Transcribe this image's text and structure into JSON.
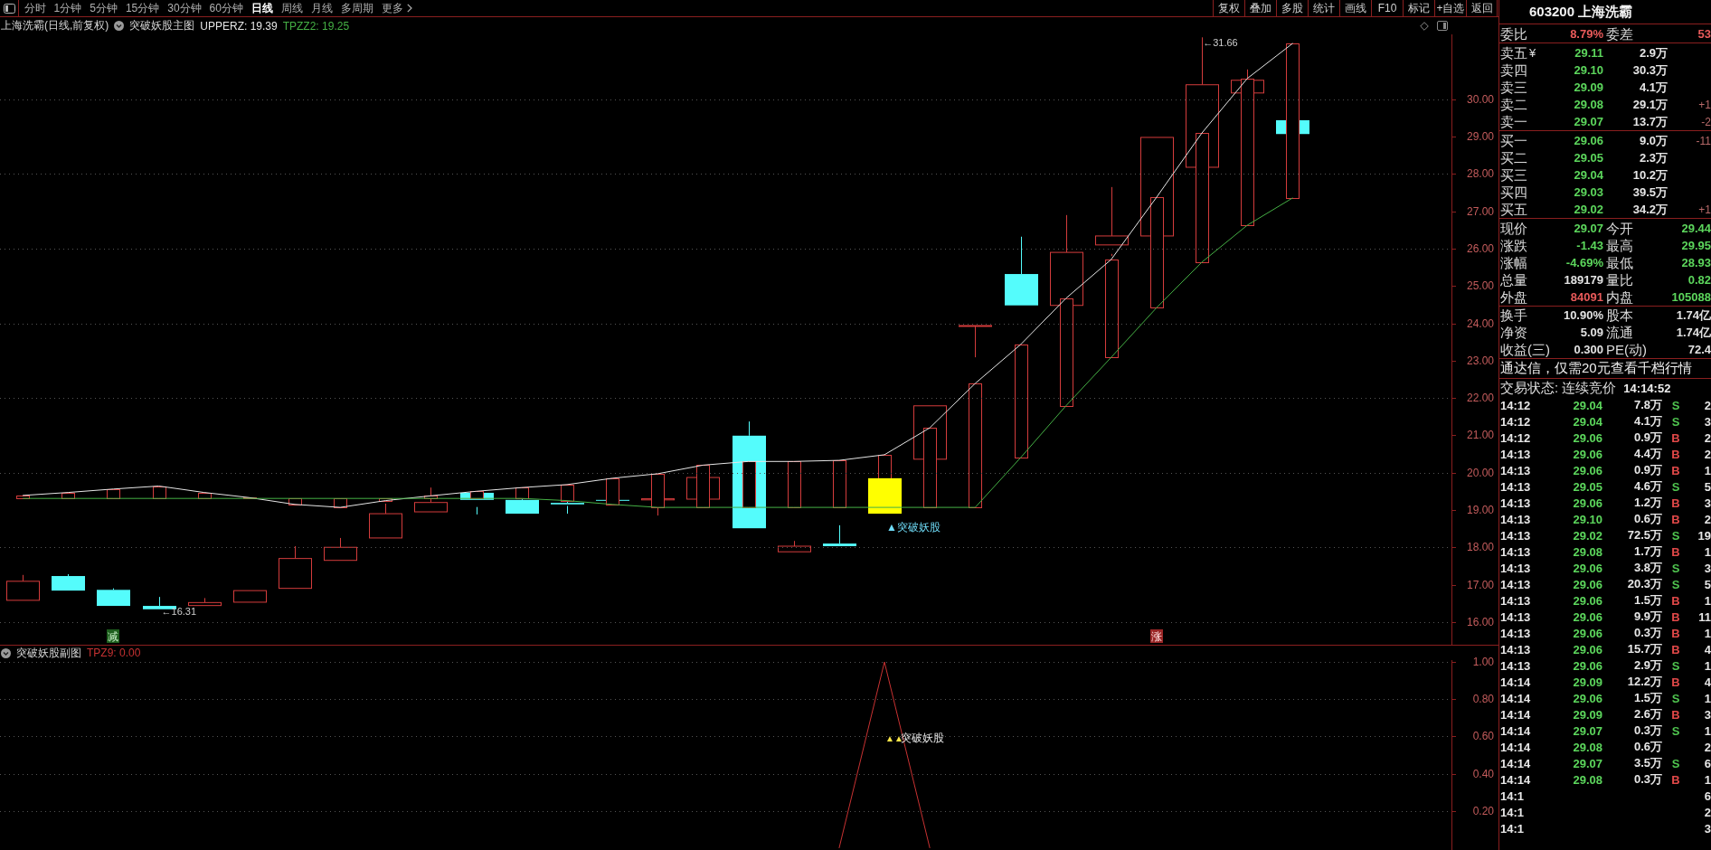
{
  "toolbar": {
    "periods": [
      {
        "label": "分时",
        "selected": false,
        "kind": "period"
      },
      {
        "label": "1分钟",
        "selected": false,
        "kind": "period"
      },
      {
        "label": "5分钟",
        "selected": false,
        "kind": "period"
      },
      {
        "label": "15分钟",
        "selected": false,
        "kind": "period"
      },
      {
        "label": "30分钟",
        "selected": false,
        "kind": "period"
      },
      {
        "label": "60分钟",
        "selected": false,
        "kind": "period"
      },
      {
        "label": "日线",
        "selected": true,
        "kind": "period"
      },
      {
        "label": "周线",
        "selected": false,
        "kind": "period"
      },
      {
        "label": "月线",
        "selected": false,
        "kind": "period"
      },
      {
        "label": "多周期",
        "selected": false,
        "kind": "period"
      },
      {
        "label": "更多",
        "selected": false,
        "kind": "menu"
      }
    ],
    "tools": [
      "复权",
      "叠加",
      "多股",
      "统计",
      "画线",
      "F10",
      "标记",
      "+自选",
      "返回"
    ]
  },
  "main_chart": {
    "title": "上海洗霸(日线,前复权)",
    "indicator": "突破妖股主图",
    "readouts": [
      "UPPERZ: 19.39",
      "TPZZ2: 19.25"
    ],
    "low_label": "←16.31",
    "high_label": "←31.66",
    "signal_label": "▲突破妖股",
    "tags": [
      {
        "label": "减",
        "kind": "sell"
      },
      {
        "label": "涨",
        "kind": "buy"
      }
    ],
    "chart_data": {
      "type": "line",
      "grid": true,
      "categories": [
        null,
        null,
        null,
        null,
        null,
        null,
        null,
        null,
        null,
        null,
        null,
        null,
        null,
        null,
        null,
        null,
        null,
        null,
        null,
        null,
        null,
        null,
        null,
        null,
        null,
        null,
        null,
        null,
        null,
        null,
        null,
        null
      ],
      "ylim": [
        15.39,
        31.74
      ],
      "yticks": [
        {
          "value": 30,
          "label": "30.00"
        },
        {
          "value": 29,
          "label": "29.00"
        },
        {
          "value": 28,
          "label": "28.00"
        },
        {
          "value": 27,
          "label": "27.00"
        },
        {
          "value": 26,
          "label": "26.00"
        },
        {
          "value": 25,
          "label": "25.00"
        },
        {
          "value": 24,
          "label": "24.00"
        },
        {
          "value": 23,
          "label": "23.00"
        },
        {
          "value": 22,
          "label": "22.00"
        },
        {
          "value": 21,
          "label": "21.00"
        },
        {
          "value": 20,
          "label": "20.00"
        },
        {
          "value": 19,
          "label": "19.00"
        },
        {
          "value": 18,
          "label": "18.00"
        },
        {
          "value": 17,
          "label": "17.00"
        },
        {
          "value": 16,
          "label": "16.00"
        }
      ],
      "series": [
        {
          "color": "#e6e6e6",
          "values": [
            19.39,
            19.47,
            19.56,
            19.64,
            19.47,
            19.33,
            19.15,
            19.07,
            19.25,
            19.38,
            19.5,
            19.6,
            19.68,
            19.85,
            19.97,
            20.2,
            20.3,
            20.3,
            20.33,
            20.48,
            21.2,
            22.39,
            23.43,
            24.67,
            25.71,
            27.38,
            29.1,
            30.56,
            31.5,
            null,
            null,
            null
          ]
        },
        {
          "color": "#45b045",
          "values": [
            19.31,
            19.31,
            19.31,
            19.31,
            19.31,
            19.31,
            19.31,
            19.31,
            19.31,
            19.31,
            19.31,
            19.31,
            19.25,
            19.15,
            19.07,
            19.07,
            19.07,
            19.07,
            19.07,
            19.07,
            19.07,
            19.07,
            20.4,
            21.79,
            23.09,
            24.42,
            25.64,
            26.63,
            27.36,
            null,
            null,
            null
          ]
        }
      ]
    }
  },
  "sub_chart": {
    "indicator": "突破妖股副图",
    "readout": "TPZ9: 0.00",
    "signal_marker": "▲▲",
    "signal_label": "突破妖股",
    "chart_data": {
      "type": "line",
      "grid": true,
      "categories": [
        null,
        null,
        null,
        null,
        null,
        null,
        null,
        null,
        null,
        null,
        null,
        null,
        null,
        null,
        null,
        null,
        null,
        null,
        null,
        null,
        null,
        null,
        null,
        null,
        null,
        null,
        null,
        null,
        null,
        null,
        null,
        null
      ],
      "ylim": [
        -0.01,
        1.01
      ],
      "yticks": [
        {
          "value": 1,
          "label": "1.00"
        },
        {
          "value": 0.8,
          "label": "0.80"
        },
        {
          "value": 0.6,
          "label": "0.60"
        },
        {
          "value": 0.4,
          "label": "0.40"
        },
        {
          "value": 0.2,
          "label": "0.20"
        }
      ],
      "series": [
        {
          "color": "#c83232",
          "values": [
            null,
            null,
            null,
            null,
            null,
            null,
            null,
            null,
            null,
            null,
            null,
            null,
            null,
            null,
            null,
            null,
            null,
            null,
            0,
            1,
            0,
            null,
            null,
            null,
            null,
            null,
            null,
            null,
            null,
            null,
            null,
            null
          ]
        }
      ]
    }
  },
  "quote": {
    "title": "603200 上海洗霸",
    "ratio": [
      {
        "label": "委比",
        "value": "8.79%",
        "color": "#e85a5a"
      },
      {
        "label": "委差",
        "value": "53",
        "color": "#e85a5a"
      }
    ],
    "asks": [
      {
        "label": "卖五",
        "marker": "¥",
        "price": "29.11",
        "color": "#5cd65c",
        "volume": "2.9万"
      },
      {
        "label": "卖四",
        "price": "29.10",
        "color": "#5cd65c",
        "volume": "30.3万"
      },
      {
        "label": "卖三",
        "price": "29.09",
        "color": "#5cd65c",
        "volume": "4.1万"
      },
      {
        "label": "卖二",
        "price": "29.08",
        "color": "#5cd65c",
        "volume": "29.1万",
        "change": "+1"
      },
      {
        "label": "卖一",
        "price": "29.07",
        "color": "#5cd65c",
        "volume": "13.7万",
        "change": "-2"
      }
    ],
    "bids": [
      {
        "label": "买一",
        "price": "29.06",
        "color": "#5cd65c",
        "volume": "9.0万",
        "change": "-11"
      },
      {
        "label": "买二",
        "price": "29.05",
        "color": "#5cd65c",
        "volume": "2.3万"
      },
      {
        "label": "买三",
        "price": "29.04",
        "color": "#5cd65c",
        "volume": "10.2万"
      },
      {
        "label": "买四",
        "price": "29.03",
        "color": "#5cd65c",
        "volume": "39.5万"
      },
      {
        "label": "买五",
        "price": "29.02",
        "color": "#5cd65c",
        "volume": "34.2万",
        "change": "+1"
      }
    ],
    "stats": [
      {
        "label": "现价",
        "value": "29.07",
        "color": "#5cd65c"
      },
      {
        "label": "今开",
        "value": "29.44",
        "color": "#5cd65c"
      },
      {
        "label": "涨跌",
        "value": "-1.43",
        "color": "#5cd65c"
      },
      {
        "label": "最高",
        "value": "29.95",
        "color": "#5cd65c"
      },
      {
        "label": "涨幅",
        "value": "-4.69%",
        "color": "#5cd65c"
      },
      {
        "label": "最低",
        "value": "28.93",
        "color": "#5cd65c"
      },
      {
        "label": "总量",
        "value": "189179",
        "color": "#e2e2e2"
      },
      {
        "label": "量比",
        "value": "0.82",
        "color": "#5cd65c"
      },
      {
        "label": "外盘",
        "value": "84091",
        "color": "#e85a5a"
      },
      {
        "label": "内盘",
        "value": "105088",
        "color": "#5cd65c"
      }
    ],
    "fundamentals": [
      {
        "label": "换手",
        "value": "10.90%"
      },
      {
        "label": "股本",
        "value": "1.74亿"
      },
      {
        "label": "净资",
        "value": "5.09"
      },
      {
        "label": "流通",
        "value": "1.74亿"
      },
      {
        "label": "收益(三)",
        "value": "0.300"
      },
      {
        "label": "PE(动)",
        "value": "72.4"
      }
    ],
    "notice": "通达信，仅需20元查看千档行情",
    "status": {
      "label": "交易状态: 连续竞价",
      "time": "14:14:52"
    },
    "trades": [
      {
        "time": "14:12",
        "price": "29.04",
        "color": "#5cd65c",
        "volume": "7.8万",
        "side": "S",
        "kind": "sell",
        "count": "2"
      },
      {
        "time": "14:12",
        "price": "29.04",
        "color": "#5cd65c",
        "volume": "4.1万",
        "side": "S",
        "kind": "sell",
        "count": "3"
      },
      {
        "time": "14:12",
        "price": "29.06",
        "color": "#5cd65c",
        "volume": "0.9万",
        "side": "B",
        "kind": "buy",
        "count": "2"
      },
      {
        "time": "14:13",
        "price": "29.06",
        "color": "#5cd65c",
        "volume": "4.4万",
        "side": "B",
        "kind": "buy",
        "count": "2"
      },
      {
        "time": "14:13",
        "price": "29.06",
        "color": "#5cd65c",
        "volume": "0.9万",
        "side": "B",
        "kind": "buy",
        "count": "1"
      },
      {
        "time": "14:13",
        "price": "29.05",
        "color": "#5cd65c",
        "volume": "4.6万",
        "side": "S",
        "kind": "sell",
        "count": "5"
      },
      {
        "time": "14:13",
        "price": "29.06",
        "color": "#5cd65c",
        "volume": "1.2万",
        "side": "B",
        "kind": "buy",
        "count": "3"
      },
      {
        "time": "14:13",
        "price": "29.10",
        "color": "#5cd65c",
        "volume": "0.6万",
        "side": "B",
        "kind": "buy",
        "count": "2"
      },
      {
        "time": "14:13",
        "price": "29.02",
        "color": "#5cd65c",
        "volume": "72.5万",
        "side": "S",
        "kind": "sell",
        "count": "19"
      },
      {
        "time": "14:13",
        "price": "29.08",
        "color": "#5cd65c",
        "volume": "1.7万",
        "side": "B",
        "kind": "buy",
        "count": "1"
      },
      {
        "time": "14:13",
        "price": "29.06",
        "color": "#5cd65c",
        "volume": "3.8万",
        "side": "S",
        "kind": "sell",
        "count": "3"
      },
      {
        "time": "14:13",
        "price": "29.06",
        "color": "#5cd65c",
        "volume": "20.3万",
        "side": "S",
        "kind": "sell",
        "count": "5"
      },
      {
        "time": "14:13",
        "price": "29.06",
        "color": "#5cd65c",
        "volume": "1.5万",
        "side": "B",
        "kind": "buy",
        "count": "1"
      },
      {
        "time": "14:13",
        "price": "29.06",
        "color": "#5cd65c",
        "volume": "9.9万",
        "side": "B",
        "kind": "buy",
        "count": "11"
      },
      {
        "time": "14:13",
        "price": "29.06",
        "color": "#5cd65c",
        "volume": "0.3万",
        "side": "B",
        "kind": "buy",
        "count": "1"
      },
      {
        "time": "14:13",
        "price": "29.06",
        "color": "#5cd65c",
        "volume": "15.7万",
        "side": "B",
        "kind": "buy",
        "count": "4"
      },
      {
        "time": "14:13",
        "price": "29.06",
        "color": "#5cd65c",
        "volume": "2.9万",
        "side": "S",
        "kind": "sell",
        "count": "1"
      },
      {
        "time": "14:14",
        "price": "29.09",
        "color": "#5cd65c",
        "volume": "12.2万",
        "side": "B",
        "kind": "buy",
        "count": "4"
      },
      {
        "time": "14:14",
        "price": "29.06",
        "color": "#5cd65c",
        "volume": "1.5万",
        "side": "S",
        "kind": "sell",
        "count": "1"
      },
      {
        "time": "14:14",
        "price": "29.09",
        "color": "#5cd65c",
        "volume": "2.6万",
        "side": "B",
        "kind": "buy",
        "count": "3"
      },
      {
        "time": "14:14",
        "price": "29.07",
        "color": "#5cd65c",
        "volume": "0.3万",
        "side": "S",
        "kind": "sell",
        "count": "1"
      },
      {
        "time": "14:14",
        "price": "29.08",
        "color": "#5cd65c",
        "volume": "0.6万",
        "count": "2"
      },
      {
        "time": "14:14",
        "price": "29.07",
        "color": "#5cd65c",
        "volume": "3.5万",
        "side": "S",
        "kind": "sell",
        "count": "6"
      },
      {
        "time": "14:14",
        "price": "29.08",
        "color": "#5cd65c",
        "volume": "0.3万",
        "side": "B",
        "kind": "buy",
        "count": "1"
      },
      {
        "time": "14:1",
        "count": "6"
      },
      {
        "time": "14:1",
        "count": "2"
      },
      {
        "time": "14:1",
        "count": "3"
      }
    ]
  }
}
